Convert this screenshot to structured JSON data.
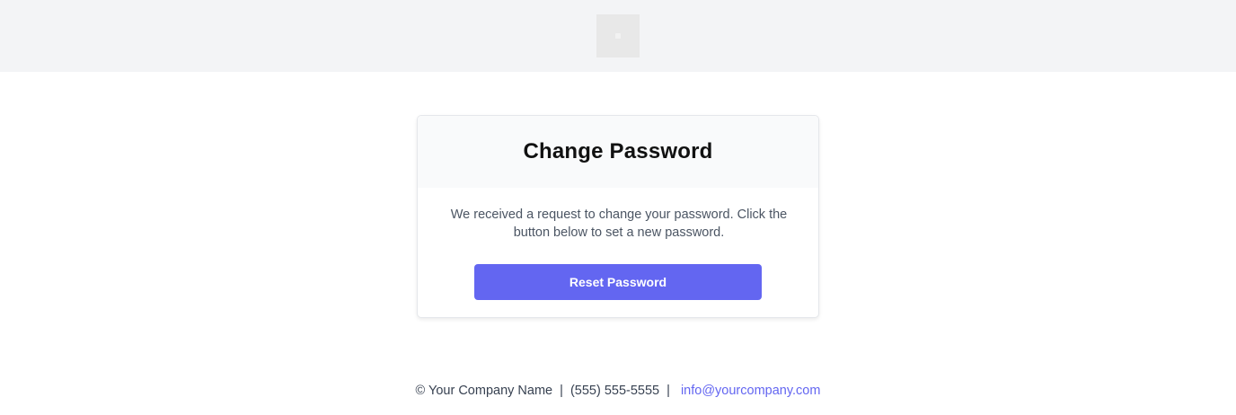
{
  "header": {
    "logo_icon": "image-placeholder-icon"
  },
  "card": {
    "title": "Change Password",
    "message": "We received a request to change your password. Click the button below to set a new password.",
    "button_label": "Reset Password"
  },
  "footer": {
    "company": "© Your Company Name",
    "separator": "|",
    "phone": "(555) 555-5555",
    "email": "info@yourcompany.com"
  },
  "colors": {
    "accent": "#6366f1",
    "header_bg": "#f3f4f6",
    "card_head_bg": "#f9fafb",
    "text_muted": "#4b5563"
  }
}
